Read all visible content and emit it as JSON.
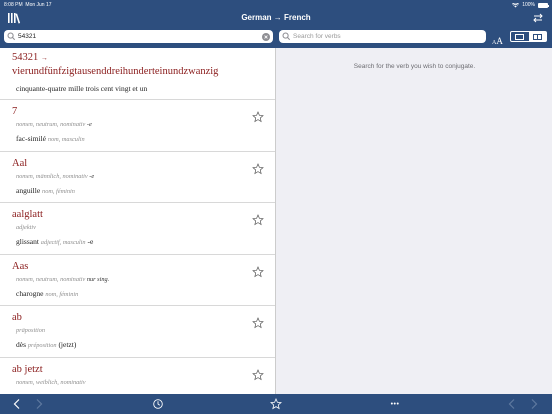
{
  "status": {
    "time": "8:08 PM",
    "date": "Mon Jun 17",
    "battery": "100%"
  },
  "header": {
    "title": "German → French"
  },
  "search": {
    "query": "54321",
    "verb_placeholder": "Search for verbs"
  },
  "font_size": {
    "small": "A",
    "large": "A"
  },
  "first_entry": {
    "number": "54321",
    "arrow": "→",
    "word": "vierundfünfzigtausenddreihunderteinundzwanzig",
    "translation": "cinquante-quatre mille trois cent vingt et un"
  },
  "entries": [
    {
      "headword": "7",
      "grammar": "nomen, neutrum, nominativ",
      "grammar_extra": "-e",
      "translation": "fac-similé",
      "trans_grammar": "nom, masculin",
      "trans_extra": ""
    },
    {
      "headword": "Aal",
      "grammar": "nomen, männlich, nominativ",
      "grammar_extra": "-e",
      "translation": "anguille",
      "trans_grammar": "nom, féminin",
      "trans_extra": ""
    },
    {
      "headword": "aalglatt",
      "grammar": "adjektiv",
      "grammar_extra": "",
      "translation": "glissant",
      "trans_grammar": "adjectif, masculin",
      "trans_extra": "-e"
    },
    {
      "headword": "Aas",
      "grammar": "nomen, neutrum, nominativ",
      "grammar_extra": "nur sing.",
      "translation": "charogne",
      "trans_grammar": "nom, féminin",
      "trans_extra": ""
    },
    {
      "headword": "ab",
      "grammar": "präposition",
      "grammar_extra": "",
      "translation": "dès",
      "trans_grammar": "préposition",
      "trans_extra": "(jetzt)"
    },
    {
      "headword": "ab jetzt",
      "grammar": "nomen, weiblich, nominativ",
      "grammar_extra": "",
      "translation": "",
      "trans_grammar": "",
      "trans_extra": ""
    }
  ],
  "detail": {
    "hint": "Search for the verb you wish to conjugate."
  },
  "toolbar": {
    "more_label": "•••"
  },
  "colors": {
    "bar": "#2d4e7e",
    "headword": "#8a1c1c",
    "accent": "#2d4e7e"
  }
}
